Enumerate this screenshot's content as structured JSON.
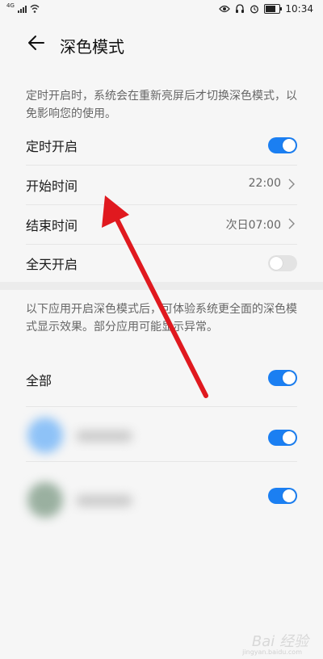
{
  "status_bar": {
    "signal_label": "4G",
    "time": "10:34",
    "icons": [
      "signal-icon",
      "wifi-icon",
      "eye-icon",
      "headphones-icon",
      "alarm-icon",
      "battery-icon"
    ]
  },
  "header": {
    "title": "深色模式",
    "back_icon": "arrow-left-icon"
  },
  "schedule_note": "定时开启时，系统会在重新亮屏后才切换深色模式，以免影响您的使用。",
  "schedule": {
    "rows": [
      {
        "label": "定时开启",
        "toggle": true
      },
      {
        "label": "开始时间",
        "value": "22:00"
      },
      {
        "label": "结束时间",
        "value": "次日07:00"
      },
      {
        "label": "全天开启",
        "toggle": false
      }
    ]
  },
  "apps_note": "以下应用开启深色模式后，可体验系统更全面的深色模式显示效果。部分应用可能显示异常。",
  "apps": {
    "all_label": "全部",
    "all_toggle": true,
    "items": [
      {
        "toggle": true
      },
      {
        "toggle": true
      }
    ]
  },
  "colors": {
    "accent": "#1b7ff2",
    "annotation_arrow": "#e0191f"
  },
  "watermark": {
    "text": "Bai 经验",
    "sub": "jingyan.baidu.com"
  }
}
